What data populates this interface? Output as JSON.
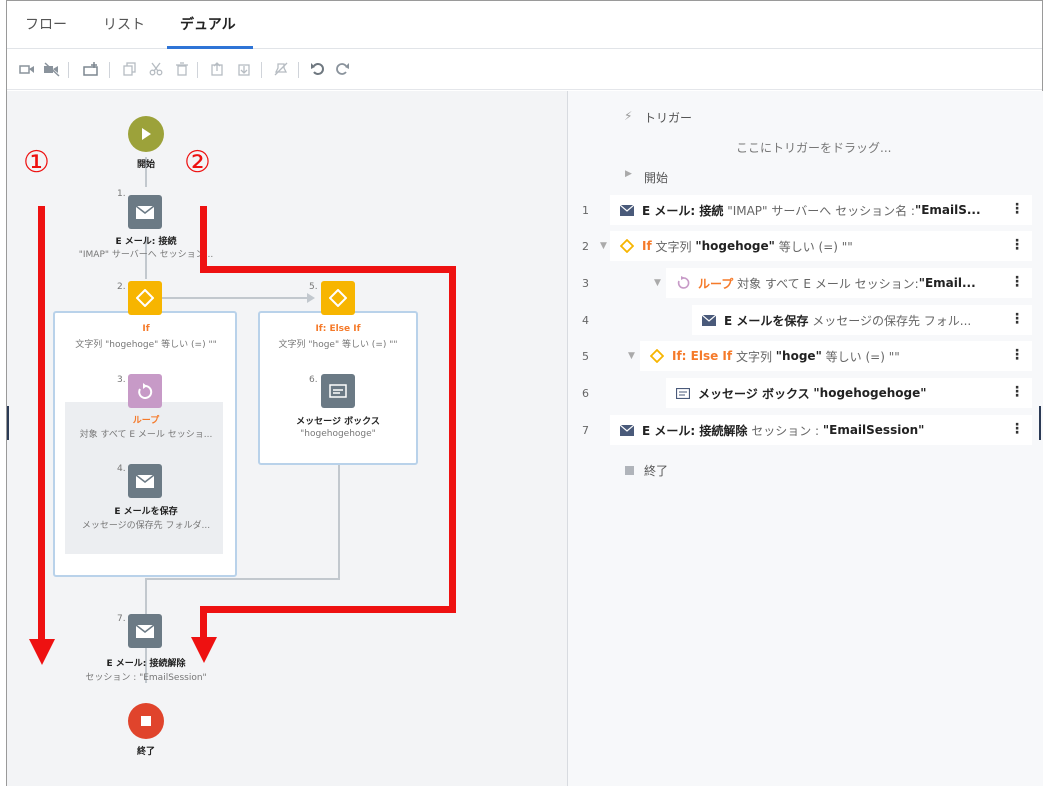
{
  "tabs": [
    {
      "label": "フロー",
      "active": false
    },
    {
      "label": "リスト",
      "active": false
    },
    {
      "label": "デュアル",
      "active": true
    }
  ],
  "toolbar": {
    "icons": [
      "record-icon",
      "record-disabled-icon",
      "add-action-icon",
      "copy-icon",
      "cut-icon",
      "delete-icon",
      "paste-above-icon",
      "paste-below-icon",
      "disable-icon",
      "undo-icon",
      "redo-icon"
    ]
  },
  "flow": {
    "start_label": "開始",
    "end_label": "終了",
    "nodes": [
      {
        "num": "1.",
        "title": "E メール: 接続",
        "subtitle": "\"IMAP\" サーバーへ セッション..."
      },
      {
        "num": "2.",
        "title": "If",
        "subtitle": "文字列 \"hogehoge\" 等しい (=) \"\""
      },
      {
        "num": "3.",
        "title": "ループ",
        "subtitle": "対象 すべて E メール セッショ..."
      },
      {
        "num": "4.",
        "title": "E メールを保存",
        "subtitle": "メッセージの保存先 フォルダ..."
      },
      {
        "num": "5.",
        "title": "If: Else If",
        "subtitle": "文字列 \"hoge\" 等しい (=) \"\""
      },
      {
        "num": "6.",
        "title": "メッセージ ボックス",
        "subtitle": "\"hogehogehoge\""
      },
      {
        "num": "7.",
        "title": "E メール: 接続解除",
        "subtitle": "セッション : \"EmailSession\""
      }
    ],
    "annotations": {
      "one": "①",
      "two": "②"
    }
  },
  "list": {
    "trigger_label": "トリガー",
    "trigger_placeholder": "ここにトリガーをドラッグ...",
    "start_label": "開始",
    "end_label": "終了",
    "rows": [
      {
        "num": "1",
        "keyword": "E メール: 接続",
        "text": "\"IMAP\" サーバーへ セッション名 :",
        "value": "\"EmailS..."
      },
      {
        "num": "2",
        "keyword": "If",
        "text": "文字列",
        "value": "\"hogehoge\"",
        "text2": "等しい (=) \"\""
      },
      {
        "num": "3",
        "keyword": "ループ",
        "text": "対象 すべて E メール セッション:",
        "value": "\"Email..."
      },
      {
        "num": "4",
        "keyword": "E メールを保存",
        "text": "メッセージの保存先 フォル..."
      },
      {
        "num": "5",
        "keyword": "If: Else If",
        "text": "文字列",
        "value": "\"hoge\"",
        "text2": "等しい (=) \"\""
      },
      {
        "num": "6",
        "keyword": "メッセージ ボックス",
        "value": "\"hogehogehoge\""
      },
      {
        "num": "7",
        "keyword": "E メール: 接続解除",
        "text": "セッション :",
        "value": "\"EmailSession\""
      }
    ]
  },
  "colors": {
    "accent": "#2e74d6",
    "annotation_red": "#ee1111",
    "if_orange": "#f57a2a",
    "diamond_yellow": "#f7b500",
    "start_green": "#9ca23a",
    "end_red": "#e0442c"
  }
}
